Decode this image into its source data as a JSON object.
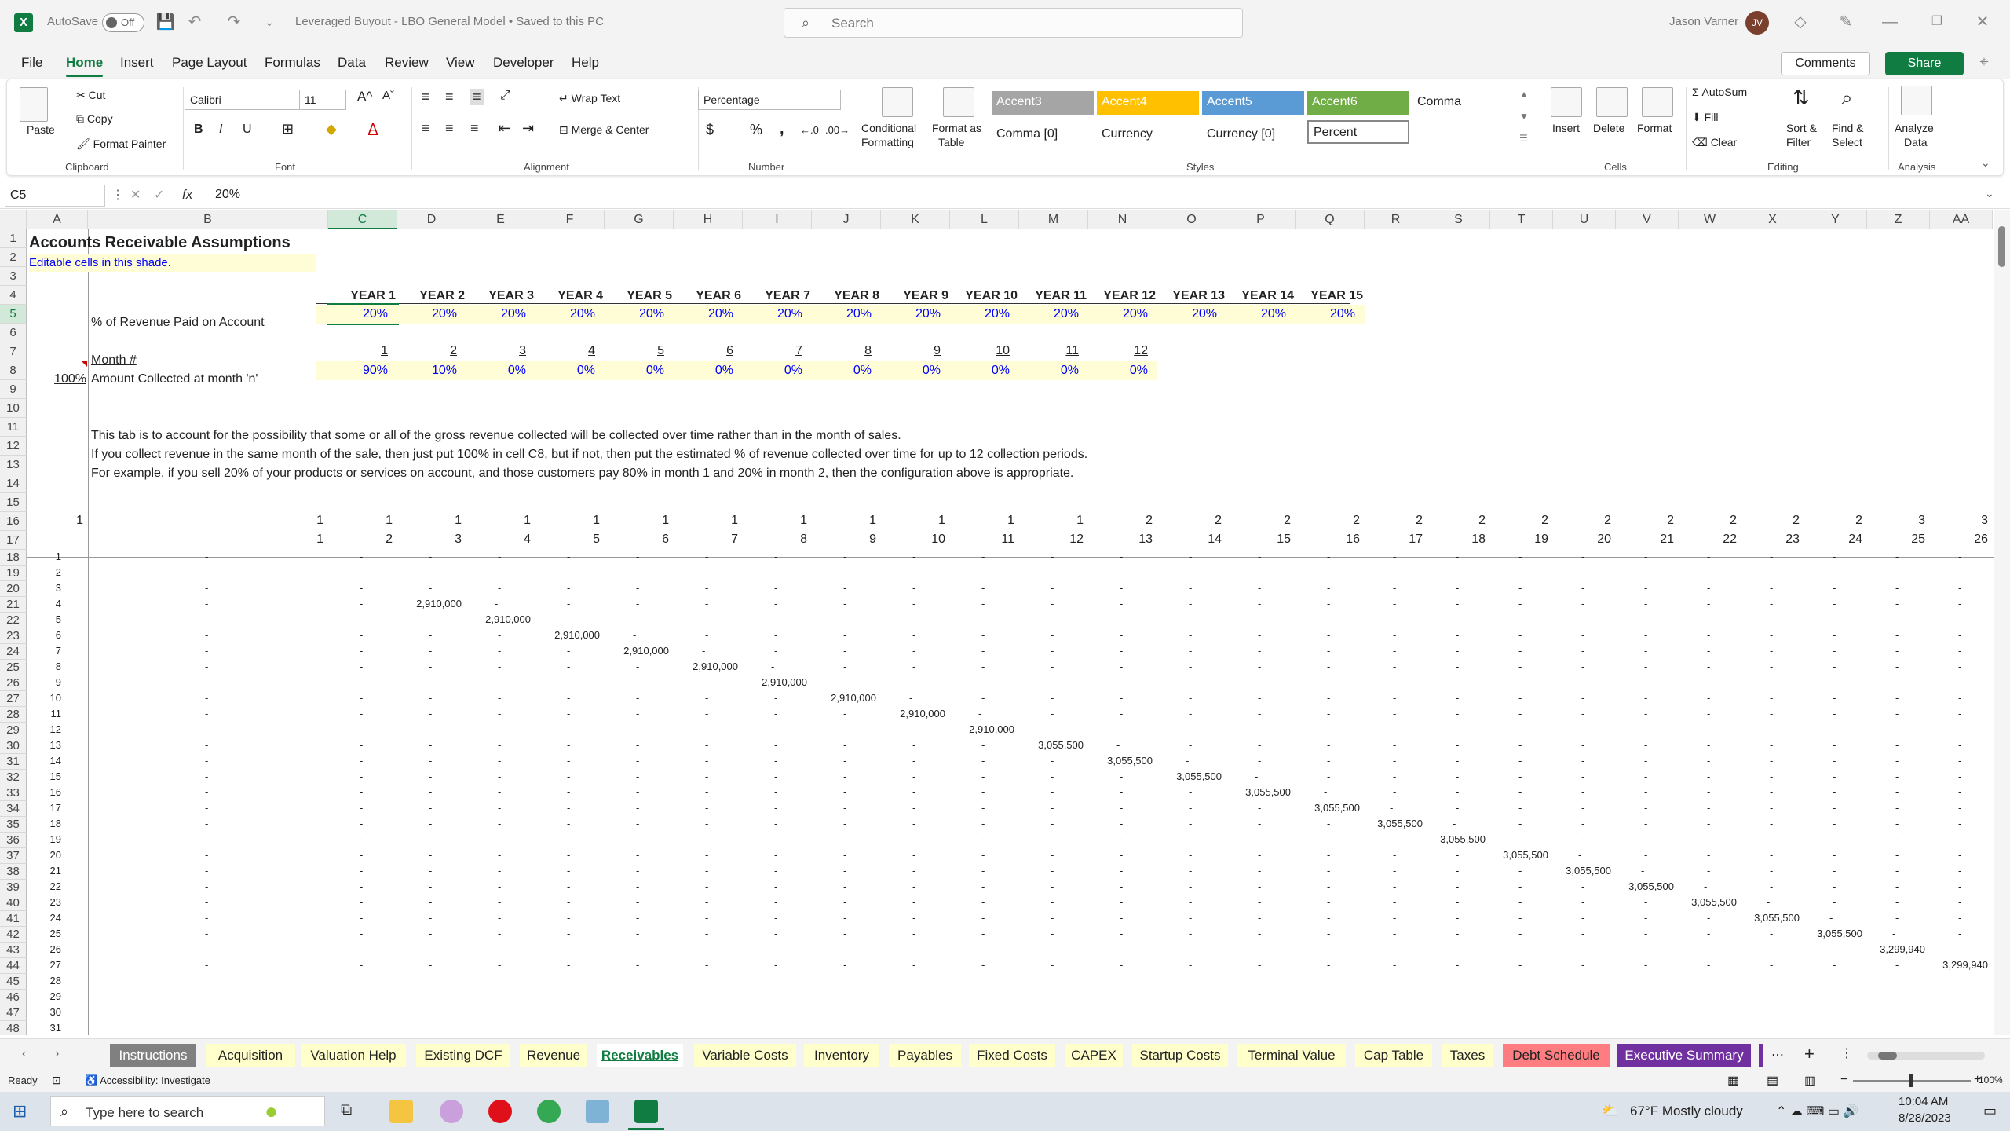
{
  "titlebar": {
    "autosave": "AutoSave",
    "toggle": "Off",
    "doc_title": "Leveraged Buyout - LBO General Model  •  Saved to this PC",
    "search_placeholder": "Search",
    "user_name": "Jason Varner",
    "user_initials": "JV",
    "logo": "X"
  },
  "menu": [
    "File",
    "Home",
    "Insert",
    "Page Layout",
    "Formulas",
    "Data",
    "Review",
    "View",
    "Developer",
    "Help"
  ],
  "actions": {
    "comments": "Comments",
    "share": "Share"
  },
  "ribbon": {
    "clipboard": {
      "paste": "Paste",
      "cut": "Cut",
      "copy": "Copy",
      "format_painter": "Format Painter",
      "label": "Clipboard"
    },
    "font": {
      "name": "Calibri",
      "size": "11",
      "bold": "B",
      "italic": "I",
      "underline": "U",
      "label": "Font"
    },
    "alignment": {
      "wrap": "Wrap Text",
      "merge": "Merge & Center",
      "label": "Alignment"
    },
    "number": {
      "format": "Percentage",
      "dollar": "$",
      "percent": "%",
      "comma": ",",
      "label": "Number"
    },
    "styles": {
      "cond": [
        "Conditional",
        "Formatting"
      ],
      "table": [
        "Format as",
        "Table"
      ],
      "cells": [
        {
          "text": "Accent3",
          "bg": "#a5a5a5",
          "fg": "#ffffff"
        },
        {
          "text": "Accent4",
          "bg": "#ffc000",
          "fg": "#ffffff"
        },
        {
          "text": "Accent5",
          "bg": "#5b9bd5",
          "fg": "#ffffff"
        },
        {
          "text": "Accent6",
          "bg": "#70ad47",
          "fg": "#ffffff"
        },
        {
          "text": "Comma",
          "bg": "#ffffff",
          "fg": "#222222"
        },
        {
          "text": "Comma [0]",
          "bg": "#ffffff",
          "fg": "#222222"
        },
        {
          "text": "Currency",
          "bg": "#ffffff",
          "fg": "#222222"
        },
        {
          "text": "Currency [0]",
          "bg": "#ffffff",
          "fg": "#222222"
        },
        {
          "text": "Percent",
          "bg": "#ffffff",
          "fg": "#222222"
        }
      ],
      "label": "Styles"
    },
    "cells": {
      "insert": "Insert",
      "delete": "Delete",
      "format": "Format",
      "label": "Cells"
    },
    "editing": {
      "autosum": "AutoSum",
      "fill": "Fill",
      "clear": "Clear",
      "sort": [
        "Sort &",
        "Filter"
      ],
      "find": [
        "Find &",
        "Select"
      ],
      "label": "Editing"
    },
    "analysis": {
      "analyze": [
        "Analyze",
        "Data"
      ],
      "label": "Analysis"
    }
  },
  "formula_bar": {
    "name_box": "C5",
    "fx": "fx",
    "value": "20%"
  },
  "columns": [
    "A",
    "B",
    "C",
    "D",
    "E",
    "F",
    "G",
    "H",
    "I",
    "J",
    "K",
    "L",
    "M",
    "N",
    "O",
    "P",
    "Q",
    "R",
    "S",
    "T",
    "U",
    "V",
    "W",
    "X",
    "Y",
    "Z",
    "AA"
  ],
  "sheet": {
    "title": "Accounts Receivable Assumptions",
    "editable_note": "Editable cells in this shade.",
    "years": [
      "YEAR 1",
      "YEAR 2",
      "YEAR 3",
      "YEAR 4",
      "YEAR 5",
      "YEAR 6",
      "YEAR 7",
      "YEAR 8",
      "YEAR 9",
      "YEAR 10",
      "YEAR 11",
      "YEAR 12",
      "YEAR 13",
      "YEAR 14",
      "YEAR 15"
    ],
    "pct_label": "% of Revenue Paid on Account",
    "pct_values": [
      "20%",
      "20%",
      "20%",
      "20%",
      "20%",
      "20%",
      "20%",
      "20%",
      "20%",
      "20%",
      "20%",
      "20%",
      "20%",
      "20%",
      "20%"
    ],
    "month_label": "Month #",
    "months": [
      "1",
      "2",
      "3",
      "4",
      "5",
      "6",
      "7",
      "8",
      "9",
      "10",
      "11",
      "12"
    ],
    "collected_total": "100%",
    "collected_label": "Amount Collected at month 'n'",
    "collected_values": [
      "90%",
      "10%",
      "0%",
      "0%",
      "0%",
      "0%",
      "0%",
      "0%",
      "0%",
      "0%",
      "0%",
      "0%"
    ],
    "notes": [
      "This tab is to account for the possibility that some or all of the gross revenue collected will be collected over time rather than in the month of sales.",
      "If you collect revenue in the same month of the sale, then just put 100% in cell C8, but if not, then put the estimated % of revenue collected over time for up to 12 collection periods.",
      "For example, if you sell 20% of your products or services on account, and those customers pay 80% in month 1 and 20% in month 2, then the configuration above is appropriate."
    ],
    "row16": [
      "1",
      "1",
      "1",
      "1",
      "1",
      "1",
      "1",
      "1",
      "1",
      "1",
      "1",
      "1",
      "1",
      "2",
      "2",
      "2",
      "2",
      "2",
      "2",
      "2",
      "2",
      "2",
      "2",
      "2",
      "2",
      "3",
      "3"
    ],
    "row17": [
      "1",
      "2",
      "3",
      "4",
      "5",
      "6",
      "7",
      "8",
      "9",
      "10",
      "11",
      "12",
      "13",
      "14",
      "15",
      "16",
      "17",
      "18",
      "19",
      "20",
      "21",
      "22",
      "23",
      "24",
      "25",
      "26"
    ],
    "matrix_values": [
      "2,910,000",
      "2,910,000",
      "2,910,000",
      "2,910,000",
      "2,910,000",
      "2,910,000",
      "2,910,000",
      "2,910,000",
      "2,910,000",
      "3,055,500",
      "3,055,500",
      "3,055,500",
      "3,055,500",
      "3,055,500",
      "3,055,500",
      "3,055,500",
      "3,055,500",
      "3,055,500",
      "3,055,500",
      "3,055,500",
      "3,055,500",
      "3,055,500",
      "3,299,940",
      "3,299,940"
    ],
    "dash": "-"
  },
  "row_numbers": [
    "1",
    "2",
    "3",
    "4",
    "5",
    "6",
    "7",
    "8",
    "9",
    "10",
    "11",
    "12",
    "13",
    "14",
    "15",
    "16",
    "17",
    "18",
    "19",
    "20",
    "21",
    "22",
    "23",
    "24",
    "25",
    "26",
    "27",
    "28",
    "29",
    "30",
    "31",
    "32",
    "33",
    "34",
    "35",
    "36",
    "37",
    "38",
    "39",
    "40",
    "41",
    "42",
    "43",
    "44",
    "45",
    "46",
    "47",
    "48"
  ],
  "sheet_tabs": [
    {
      "name": "Instructions",
      "bg": "#808080",
      "fg": "#ffffff"
    },
    {
      "name": "Acquisition",
      "bg": "#ffffcc",
      "fg": "#222222"
    },
    {
      "name": "Valuation Help",
      "bg": "#ffffcc",
      "fg": "#222222"
    },
    {
      "name": "Existing DCF",
      "bg": "#ffffcc",
      "fg": "#222222"
    },
    {
      "name": "Revenue",
      "bg": "#ffffcc",
      "fg": "#222222"
    },
    {
      "name": "Receivables",
      "bg": "#ffffff",
      "fg": "#107c41"
    },
    {
      "name": "Variable Costs",
      "bg": "#ffffcc",
      "fg": "#222222"
    },
    {
      "name": "Inventory",
      "bg": "#ffffcc",
      "fg": "#222222"
    },
    {
      "name": "Payables",
      "bg": "#ffffcc",
      "fg": "#222222"
    },
    {
      "name": "Fixed Costs",
      "bg": "#ffffcc",
      "fg": "#222222"
    },
    {
      "name": "CAPEX",
      "bg": "#ffffcc",
      "fg": "#222222"
    },
    {
      "name": "Startup Costs",
      "bg": "#ffffcc",
      "fg": "#222222"
    },
    {
      "name": "Terminal Value",
      "bg": "#ffffcc",
      "fg": "#222222"
    },
    {
      "name": "Cap Table",
      "bg": "#ffffcc",
      "fg": "#222222"
    },
    {
      "name": "Taxes",
      "bg": "#ffffcc",
      "fg": "#222222"
    },
    {
      "name": "Debt Schedule",
      "bg": "#ff7c80",
      "fg": "#222222"
    },
    {
      "name": "Executive Summary",
      "bg": "#7030a0",
      "fg": "#ffffff"
    }
  ],
  "status": {
    "ready": "Ready",
    "accessibility": "Accessibility: Investigate",
    "zoom": "100%"
  },
  "taskbar": {
    "search_placeholder": "Type here to search",
    "weather": "67°F  Mostly cloudy",
    "time": "10:04 AM",
    "date": "8/28/2023"
  }
}
